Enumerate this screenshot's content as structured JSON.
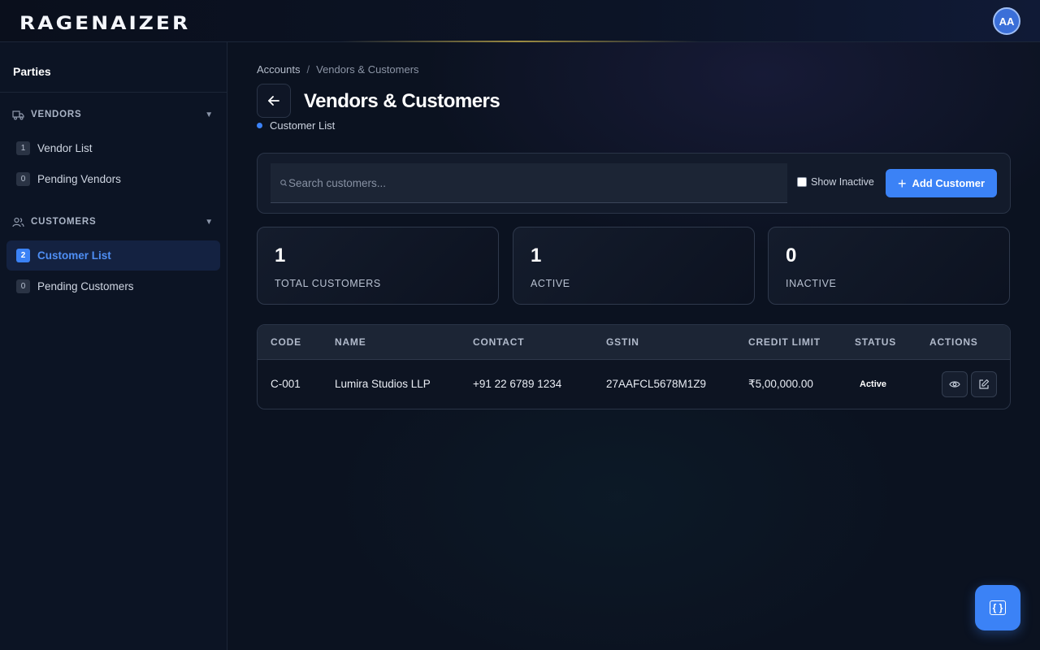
{
  "app": {
    "logo": "RAGENAIZER",
    "avatar_initials": "AA"
  },
  "sidebar": {
    "title": "Parties",
    "sections": [
      {
        "label": "VENDORS",
        "items": [
          {
            "badge": "1",
            "label": "Vendor List"
          },
          {
            "badge": "0",
            "label": "Pending Vendors"
          }
        ]
      },
      {
        "label": "CUSTOMERS",
        "items": [
          {
            "badge": "2",
            "label": "Customer List"
          },
          {
            "badge": "0",
            "label": "Pending Customers"
          }
        ]
      }
    ]
  },
  "breadcrumb": {
    "parent": "Accounts",
    "separator": "/",
    "current": "Vendors & Customers"
  },
  "page": {
    "title": "Vendors & Customers",
    "subtitle": "Customer List"
  },
  "toolbar": {
    "search_placeholder": "Search customers...",
    "search_value": "",
    "show_inactive_label": "Show Inactive",
    "add_button_label": "Add Customer"
  },
  "stats": [
    {
      "value": "1",
      "label": "TOTAL CUSTOMERS"
    },
    {
      "value": "1",
      "label": "ACTIVE"
    },
    {
      "value": "0",
      "label": "INACTIVE"
    }
  ],
  "table": {
    "headers": [
      "CODE",
      "NAME",
      "CONTACT",
      "GSTIN",
      "CREDIT LIMIT",
      "STATUS",
      "ACTIONS"
    ],
    "rows": [
      {
        "code": "C-001",
        "name": "Lumira Studios LLP",
        "contact": "+91 22 6789 1234",
        "gstin": "27AAFCL5678M1Z9",
        "credit_limit": "₹5,00,000.00",
        "status": "Active"
      }
    ]
  },
  "colors": {
    "accent": "#3b82f6",
    "background": "#0b1220",
    "sidebar": "#0c1424"
  },
  "icons": [
    "truck-icon",
    "users-icon",
    "chevron-down-icon",
    "arrow-left-icon",
    "search-icon",
    "plus-icon",
    "eye-icon",
    "edit-icon",
    "assistant-icon"
  ]
}
